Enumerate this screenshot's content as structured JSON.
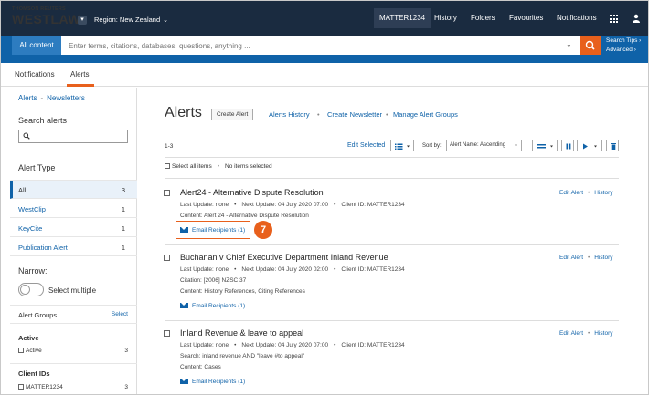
{
  "header": {
    "brand_top": "THOMSON REUTERS",
    "brand_main": "WESTLAW",
    "region": "Region: New Zealand",
    "matter": "MATTER1234",
    "nav": [
      "History",
      "Folders",
      "Favourites",
      "Notifications"
    ]
  },
  "search": {
    "scope": "All content",
    "placeholder": "Enter terms, citations, databases, questions, anything ...",
    "tips": "Search Tips",
    "advanced": "Advanced"
  },
  "tabs": [
    "Notifications",
    "Alerts"
  ],
  "sidebar": {
    "crumbs": [
      "Alerts",
      "Newsletters"
    ],
    "search_title": "Search alerts",
    "type_title": "Alert Type",
    "types": [
      {
        "label": "All",
        "count": "3"
      },
      {
        "label": "WestClip",
        "count": "1"
      },
      {
        "label": "KeyCite",
        "count": "1"
      },
      {
        "label": "Publication Alert",
        "count": "1"
      }
    ],
    "narrow_title": "Narrow:",
    "select_multiple": "Select multiple",
    "alert_groups": "Alert Groups",
    "select": "Select",
    "active_title": "Active",
    "active_item": {
      "label": "Active",
      "count": "3"
    },
    "client_title": "Client IDs",
    "client_item": {
      "label": "MATTER1234",
      "count": "3"
    }
  },
  "main": {
    "title": "Alerts",
    "create_alert": "Create Alert",
    "links": [
      "Alerts History",
      "Create Newsletter",
      "Manage Alert Groups"
    ],
    "count": "1-3",
    "edit_selected": "Edit Selected",
    "sort_by": "Sort by:",
    "sort_value": "Alert Name: Ascending",
    "select_all": "Select all items",
    "no_items": "No items selected",
    "callout": "7",
    "alerts": [
      {
        "title": "Alert24 - Alternative Dispute Resolution",
        "update": "Last Update: none",
        "next": "Next Update: 04 July 2020 07:00",
        "client": "Client ID: MATTER1234",
        "line2": "Content: Alert 24 - Alternative Dispute Resolution",
        "line3": "",
        "email": "Email Recipients (1)"
      },
      {
        "title": "Buchanan v Chief Executive Department Inland Revenue",
        "update": "Last Update: none",
        "next": "Next Update: 04 July 2020 02:00",
        "client": "Client ID: MATTER1234",
        "line2": "Citation: [2006] NZSC 37",
        "line3": "Content: History References, Citing References",
        "email": "Email Recipients (1)"
      },
      {
        "title": "Inland Revenue & leave to appeal",
        "update": "Last Update: none",
        "next": "Next Update: 04 July 2020 07:00",
        "client": "Client ID: MATTER1234",
        "line2": "Search: inland revenue AND \"leave #to appeal\"",
        "line3": "Content: Cases",
        "email": "Email Recipients (1)"
      }
    ],
    "edit_alert": "Edit Alert",
    "history": "History"
  }
}
